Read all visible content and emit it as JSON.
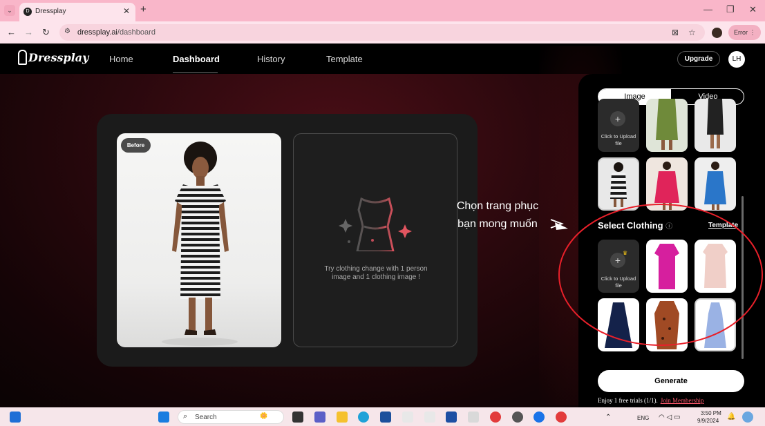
{
  "browser": {
    "tab_title": "Dressplay",
    "url_domain": "dressplay.ai",
    "url_path": "/dashboard",
    "error_label": "Error"
  },
  "site": {
    "logo": "Dressplay",
    "nav": [
      "Home",
      "Dashboard",
      "History",
      "Template"
    ],
    "active_nav": "Dashboard",
    "upgrade_label": "Upgrade",
    "avatar_initials": "LH"
  },
  "stage": {
    "before_label": "Before",
    "result_hint": "Try clothing change with 1 person image and 1 clothing image !"
  },
  "panel": {
    "tab_image": "Image",
    "tab_video": "Video",
    "upload_text": "Click to Upload file",
    "select_clothing_title": "Select Clothing",
    "info_icon": "ⓘ",
    "template_link": "Template",
    "generate_label": "Generate",
    "trial_text": "Enjoy 1 free trials (1/1).",
    "join_link": "Join Membership"
  },
  "annotation": {
    "line1": "Chọn trang phục",
    "line2": "bạn mong muốn"
  },
  "taskbar": {
    "search_placeholder": "Search",
    "language": "ENG",
    "time": "3:50 PM",
    "date": "9/9/2024"
  },
  "colors": {
    "accent_pink": "#f9b6c9",
    "annotation_red": "#e8202a",
    "join_link": "#ff5a6e"
  }
}
